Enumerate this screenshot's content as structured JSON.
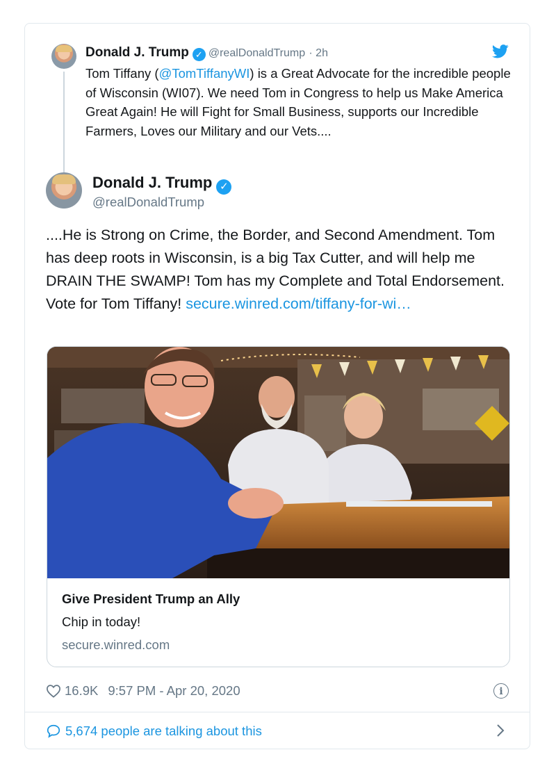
{
  "parent_tweet": {
    "name": "Donald J. Trump",
    "handle": "@realDonaldTrump",
    "time": "· 2h",
    "text_before": "Tom Tiffany (",
    "mention": "@TomTiffanyWI",
    "text_after": ") is a Great Advocate for the incredible people of Wisconsin (WI07). We need Tom in Congress to help us Make America Great Again! He will Fight for Small Business, supports our Incredible Farmers, Loves our Military and our Vets...."
  },
  "main_tweet": {
    "name": "Donald J. Trump",
    "handle": "@realDonaldTrump",
    "text": "....He is Strong on Crime, the Border, and Second Amendment. Tom has deep roots in Wisconsin, is a big Tax Cutter, and will help me DRAIN THE SWAMP! Tom has my Complete and Total Endorsement. Vote for Tom Tiffany! ",
    "link": "secure.winred.com/tiffany-for-wi…"
  },
  "link_card": {
    "title": "Give President Trump an Ally",
    "description": "Chip in today!",
    "domain": "secure.winred.com"
  },
  "footer": {
    "likes": "16.9K",
    "timestamp": "9:57 PM - Apr 20, 2020",
    "talking": "5,674 people are talking about this"
  },
  "colors": {
    "link": "#1b95e0",
    "verified": "#1da1f2",
    "muted": "#657786"
  },
  "icons": [
    "verified-badge-icon",
    "twitter-bird-icon",
    "heart-icon",
    "info-icon",
    "speech-bubble-icon",
    "chevron-right-icon"
  ]
}
